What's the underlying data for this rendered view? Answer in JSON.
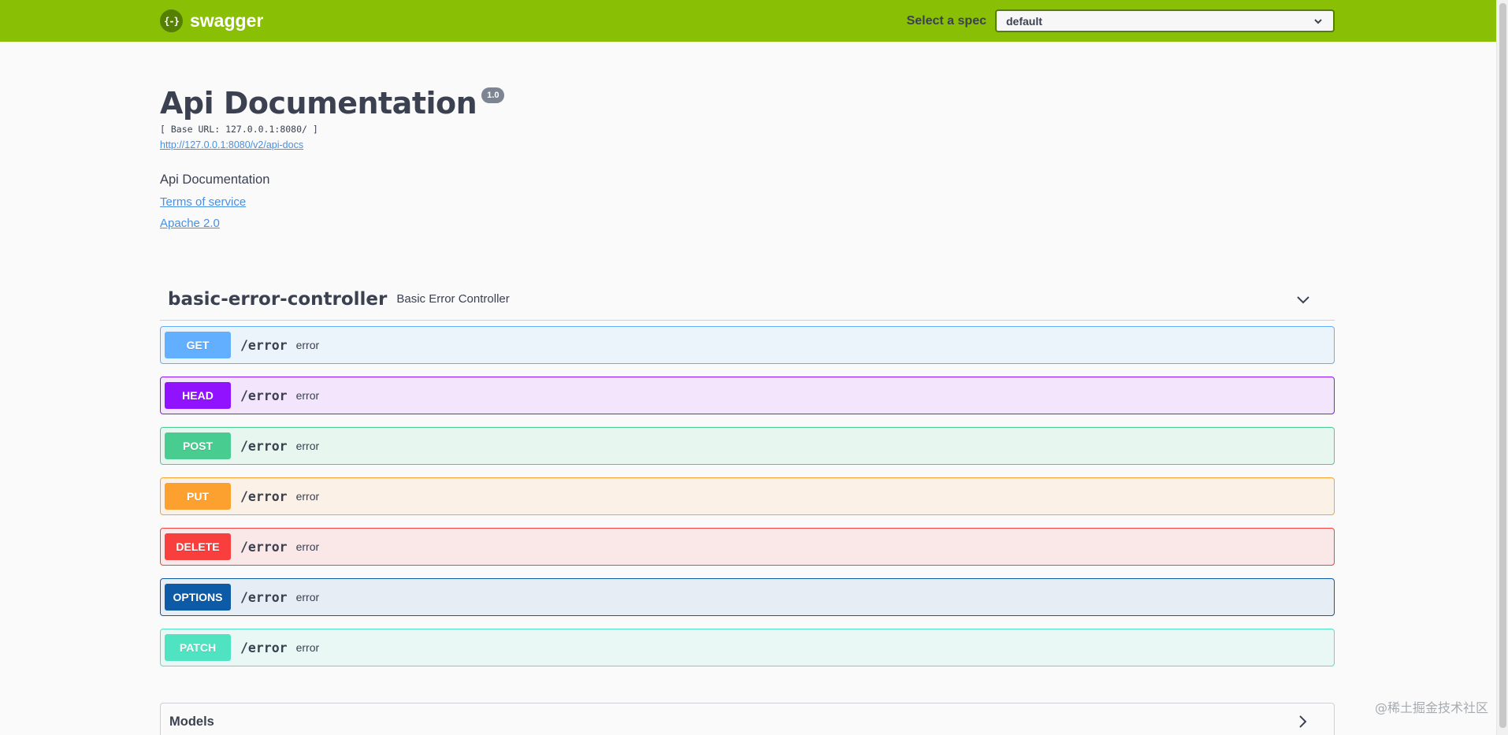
{
  "topbar": {
    "logo_text": "swagger",
    "logo_glyph": "{-}",
    "spec_label": "Select a spec",
    "spec_value": "default"
  },
  "info": {
    "title": "Api Documentation",
    "version": "1.0",
    "base_url": "[ Base URL: 127.0.0.1:8080/ ]",
    "spec_url": "http://127.0.0.1:8080/v2/api-docs",
    "description": "Api Documentation",
    "terms_link": "Terms of service",
    "license_link": "Apache 2.0"
  },
  "tag": {
    "name": "basic-error-controller",
    "description": "Basic Error Controller"
  },
  "operations": [
    {
      "method": "GET",
      "path": "/error",
      "summary": "error"
    },
    {
      "method": "HEAD",
      "path": "/error",
      "summary": "error"
    },
    {
      "method": "POST",
      "path": "/error",
      "summary": "error"
    },
    {
      "method": "PUT",
      "path": "/error",
      "summary": "error"
    },
    {
      "method": "DELETE",
      "path": "/error",
      "summary": "error"
    },
    {
      "method": "OPTIONS",
      "path": "/error",
      "summary": "error"
    },
    {
      "method": "PATCH",
      "path": "/error",
      "summary": "error"
    }
  ],
  "models": {
    "title": "Models"
  },
  "watermark": "@稀土掘金技术社区",
  "colors": {
    "topbar": "#89bf04",
    "get": "#61affe",
    "head": "#9012fe",
    "post": "#49cc90",
    "put": "#fca130",
    "delete": "#f93e3e",
    "options": "#0d5aa7",
    "patch": "#50e3c2",
    "link": "#4990e2"
  },
  "icons": {
    "spec_select": "chevron-down-icon",
    "tag_toggle": "chevron-down-icon",
    "models_toggle": "chevron-right-icon"
  }
}
